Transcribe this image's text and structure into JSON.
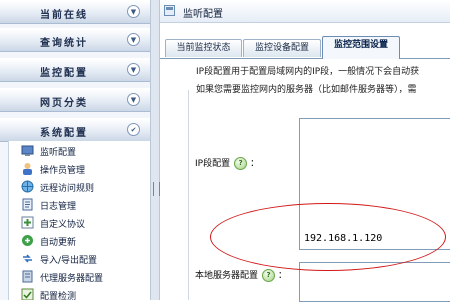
{
  "nav": {
    "headers": [
      {
        "label": "当前在线",
        "icon": "chevron-down-icon",
        "glyph": "▼"
      },
      {
        "label": "查询统计",
        "icon": "chevron-down-icon",
        "glyph": "▼"
      },
      {
        "label": "监控配置",
        "icon": "chevron-down-icon",
        "glyph": "▼"
      },
      {
        "label": "网页分类",
        "icon": "chevron-down-icon",
        "glyph": "▼"
      },
      {
        "label": "系统配置",
        "icon": "chevron-up-icon",
        "glyph": "✔"
      }
    ],
    "items": [
      {
        "label": "监听配置",
        "icon": "monitor-config-icon"
      },
      {
        "label": "操作员管理",
        "icon": "operator-icon"
      },
      {
        "label": "远程访问规则",
        "icon": "remote-access-icon"
      },
      {
        "label": "日志管理",
        "icon": "log-icon"
      },
      {
        "label": "自定义协议",
        "icon": "protocol-icon"
      },
      {
        "label": "自动更新",
        "icon": "update-icon"
      },
      {
        "label": "导入/导出配置",
        "icon": "import-export-icon"
      },
      {
        "label": "代理服务器配置",
        "icon": "proxy-icon"
      },
      {
        "label": "配置检测",
        "icon": "check-icon"
      }
    ]
  },
  "main": {
    "title": "监听配置",
    "tabs": [
      {
        "label": "当前监控状态",
        "active": false
      },
      {
        "label": "监控设备配置",
        "active": false
      },
      {
        "label": "监控范围设置",
        "active": true
      }
    ],
    "description_lines": [
      "IP段配置用于配置局域网内的IP段，一般情况下会自动获",
      "如果您需要监控网内的服务器（比如邮件服务器等），需"
    ],
    "ip_segment_label": "IP段配置",
    "ip_segment_value": "192.168.1.120",
    "local_server_label": "本地服务器配置",
    "help_glyph": "?",
    "label_suffix": "："
  },
  "colors": {
    "highlight": "#d21818",
    "accent": "#6c8db3"
  }
}
